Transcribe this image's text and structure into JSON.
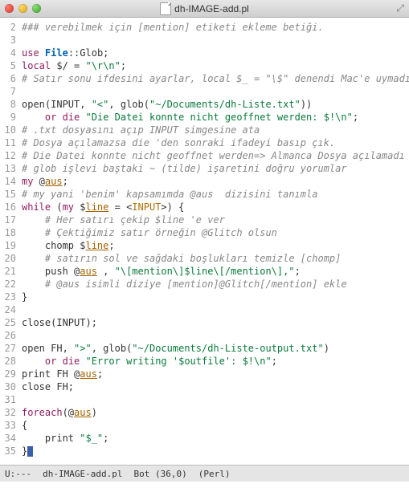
{
  "window": {
    "title": "dh-IMAGE-add.pl",
    "traffic": [
      "close",
      "minimize",
      "zoom"
    ],
    "fullscreen_glyph": "⤢"
  },
  "gutter": {
    "start": 2,
    "end": 35
  },
  "code": [
    {
      "n": 2,
      "t": [
        [
          "com",
          "### verebilmek için [mention] etiketi ekleme betiği."
        ]
      ]
    },
    {
      "n": 3,
      "t": []
    },
    {
      "n": 4,
      "t": [
        [
          "kw",
          "use"
        ],
        [
          "p",
          " "
        ],
        [
          "func",
          "File"
        ],
        [
          "p",
          "::Glob;"
        ]
      ]
    },
    {
      "n": 5,
      "t": [
        [
          "kw",
          "local"
        ],
        [
          "p",
          " $/ = "
        ],
        [
          "str",
          "\"\\r\\n\""
        ],
        [
          "p",
          ";"
        ]
      ]
    },
    {
      "n": 6,
      "t": [
        [
          "com",
          "# Satır sonu ifdesini ayarlar, local $_ = \"\\$\" denendi Mac'e uymadı"
        ]
      ]
    },
    {
      "n": 7,
      "t": []
    },
    {
      "n": 8,
      "t": [
        [
          "p",
          "open(INPUT, "
        ],
        [
          "str",
          "\"<\""
        ],
        [
          "p",
          ", glob("
        ],
        [
          "str",
          "\"~/Documents/dh-Liste.txt\""
        ],
        [
          "p",
          "))"
        ]
      ]
    },
    {
      "n": 9,
      "t": [
        [
          "p",
          "    "
        ],
        [
          "kw",
          "or"
        ],
        [
          "p",
          " "
        ],
        [
          "kw",
          "die"
        ],
        [
          "p",
          " "
        ],
        [
          "str",
          "\"Die Datei konnte nicht geoffnet werden: $!\\n\""
        ],
        [
          "p",
          ";"
        ]
      ]
    },
    {
      "n": 10,
      "t": [
        [
          "com",
          "# .txt dosyasını açıp INPUT simgesine ata"
        ]
      ]
    },
    {
      "n": 11,
      "t": [
        [
          "com",
          "# Dosya açılamazsa die 'den sonraki ifadeyi basıp çık."
        ]
      ]
    },
    {
      "n": 12,
      "t": [
        [
          "com",
          "# Die Datei konnte nicht geoffnet werden=> Almanca Dosya açılamadı"
        ]
      ]
    },
    {
      "n": 13,
      "t": [
        [
          "com",
          "# glob işlevi baştaki ~ (tilde) işaretini doğru yorumlar"
        ]
      ]
    },
    {
      "n": 14,
      "t": [
        [
          "kw",
          "my"
        ],
        [
          "p",
          " @"
        ],
        [
          "var",
          "aus"
        ],
        [
          "p",
          ";"
        ]
      ]
    },
    {
      "n": 15,
      "t": [
        [
          "com",
          "# my yani 'benim' kapsamımda @aus  dizisini tanımla"
        ]
      ]
    },
    {
      "n": 16,
      "t": [
        [
          "kw",
          "while"
        ],
        [
          "p",
          " ("
        ],
        [
          "kw",
          "my"
        ],
        [
          "p",
          " $"
        ],
        [
          "var",
          "line"
        ],
        [
          "p",
          " = <"
        ],
        [
          "bracket",
          "INPUT"
        ],
        [
          "p",
          ">) {"
        ]
      ]
    },
    {
      "n": 17,
      "t": [
        [
          "p",
          "    "
        ],
        [
          "com",
          "# Her satırı çekip $line 'e ver"
        ]
      ]
    },
    {
      "n": 18,
      "t": [
        [
          "p",
          "    "
        ],
        [
          "com",
          "# Çektiğimiz satır örneğin @Glitch olsun"
        ]
      ]
    },
    {
      "n": 19,
      "t": [
        [
          "p",
          "    chomp $"
        ],
        [
          "var",
          "line"
        ],
        [
          "p",
          ";"
        ]
      ]
    },
    {
      "n": 20,
      "t": [
        [
          "p",
          "    "
        ],
        [
          "com",
          "# satırın sol ve sağdaki boşlukları temizle [chomp]"
        ]
      ]
    },
    {
      "n": 21,
      "t": [
        [
          "p",
          "    push @"
        ],
        [
          "var",
          "aus"
        ],
        [
          "p",
          " , "
        ],
        [
          "str",
          "\"\\[mention\\]$line\\[/mention\\],\""
        ],
        [
          "p",
          ";"
        ]
      ]
    },
    {
      "n": 22,
      "t": [
        [
          "p",
          "    "
        ],
        [
          "com",
          "# @aus isimli diziye [mention]@Glitch[/mention] ekle"
        ]
      ]
    },
    {
      "n": 23,
      "t": [
        [
          "p",
          "}"
        ]
      ]
    },
    {
      "n": 24,
      "t": []
    },
    {
      "n": 25,
      "t": [
        [
          "p",
          "close(INPUT);"
        ]
      ]
    },
    {
      "n": 26,
      "t": []
    },
    {
      "n": 27,
      "t": [
        [
          "p",
          "open FH, "
        ],
        [
          "str",
          "\">\""
        ],
        [
          "p",
          ", glob("
        ],
        [
          "str",
          "\"~/Documents/dh-Liste-output.txt\""
        ],
        [
          "p",
          ")"
        ]
      ]
    },
    {
      "n": 28,
      "t": [
        [
          "p",
          "    "
        ],
        [
          "kw",
          "or"
        ],
        [
          "p",
          " "
        ],
        [
          "kw",
          "die"
        ],
        [
          "p",
          " "
        ],
        [
          "str",
          "\"Error writing '$outfile': $!\\n\""
        ],
        [
          "p",
          ";"
        ]
      ]
    },
    {
      "n": 29,
      "t": [
        [
          "p",
          "print FH @"
        ],
        [
          "var",
          "aus"
        ],
        [
          "p",
          ";"
        ]
      ]
    },
    {
      "n": 30,
      "t": [
        [
          "p",
          "close FH;"
        ]
      ]
    },
    {
      "n": 31,
      "t": []
    },
    {
      "n": 32,
      "t": [
        [
          "kw",
          "foreach"
        ],
        [
          "p",
          "(@"
        ],
        [
          "var",
          "aus"
        ],
        [
          "p",
          ")"
        ]
      ]
    },
    {
      "n": 33,
      "t": [
        [
          "p",
          "{"
        ]
      ]
    },
    {
      "n": 34,
      "t": [
        [
          "p",
          "    print "
        ],
        [
          "str",
          "\"$_\""
        ],
        [
          "p",
          ";"
        ]
      ]
    },
    {
      "n": 35,
      "t": [
        [
          "p",
          "}"
        ],
        [
          "cursor",
          ""
        ]
      ]
    }
  ],
  "modeline": {
    "left": "U:---",
    "buffer": "dh-IMAGE-add.pl",
    "position": "Bot (36,0)",
    "mode": "(Perl)"
  },
  "chart_data": null
}
